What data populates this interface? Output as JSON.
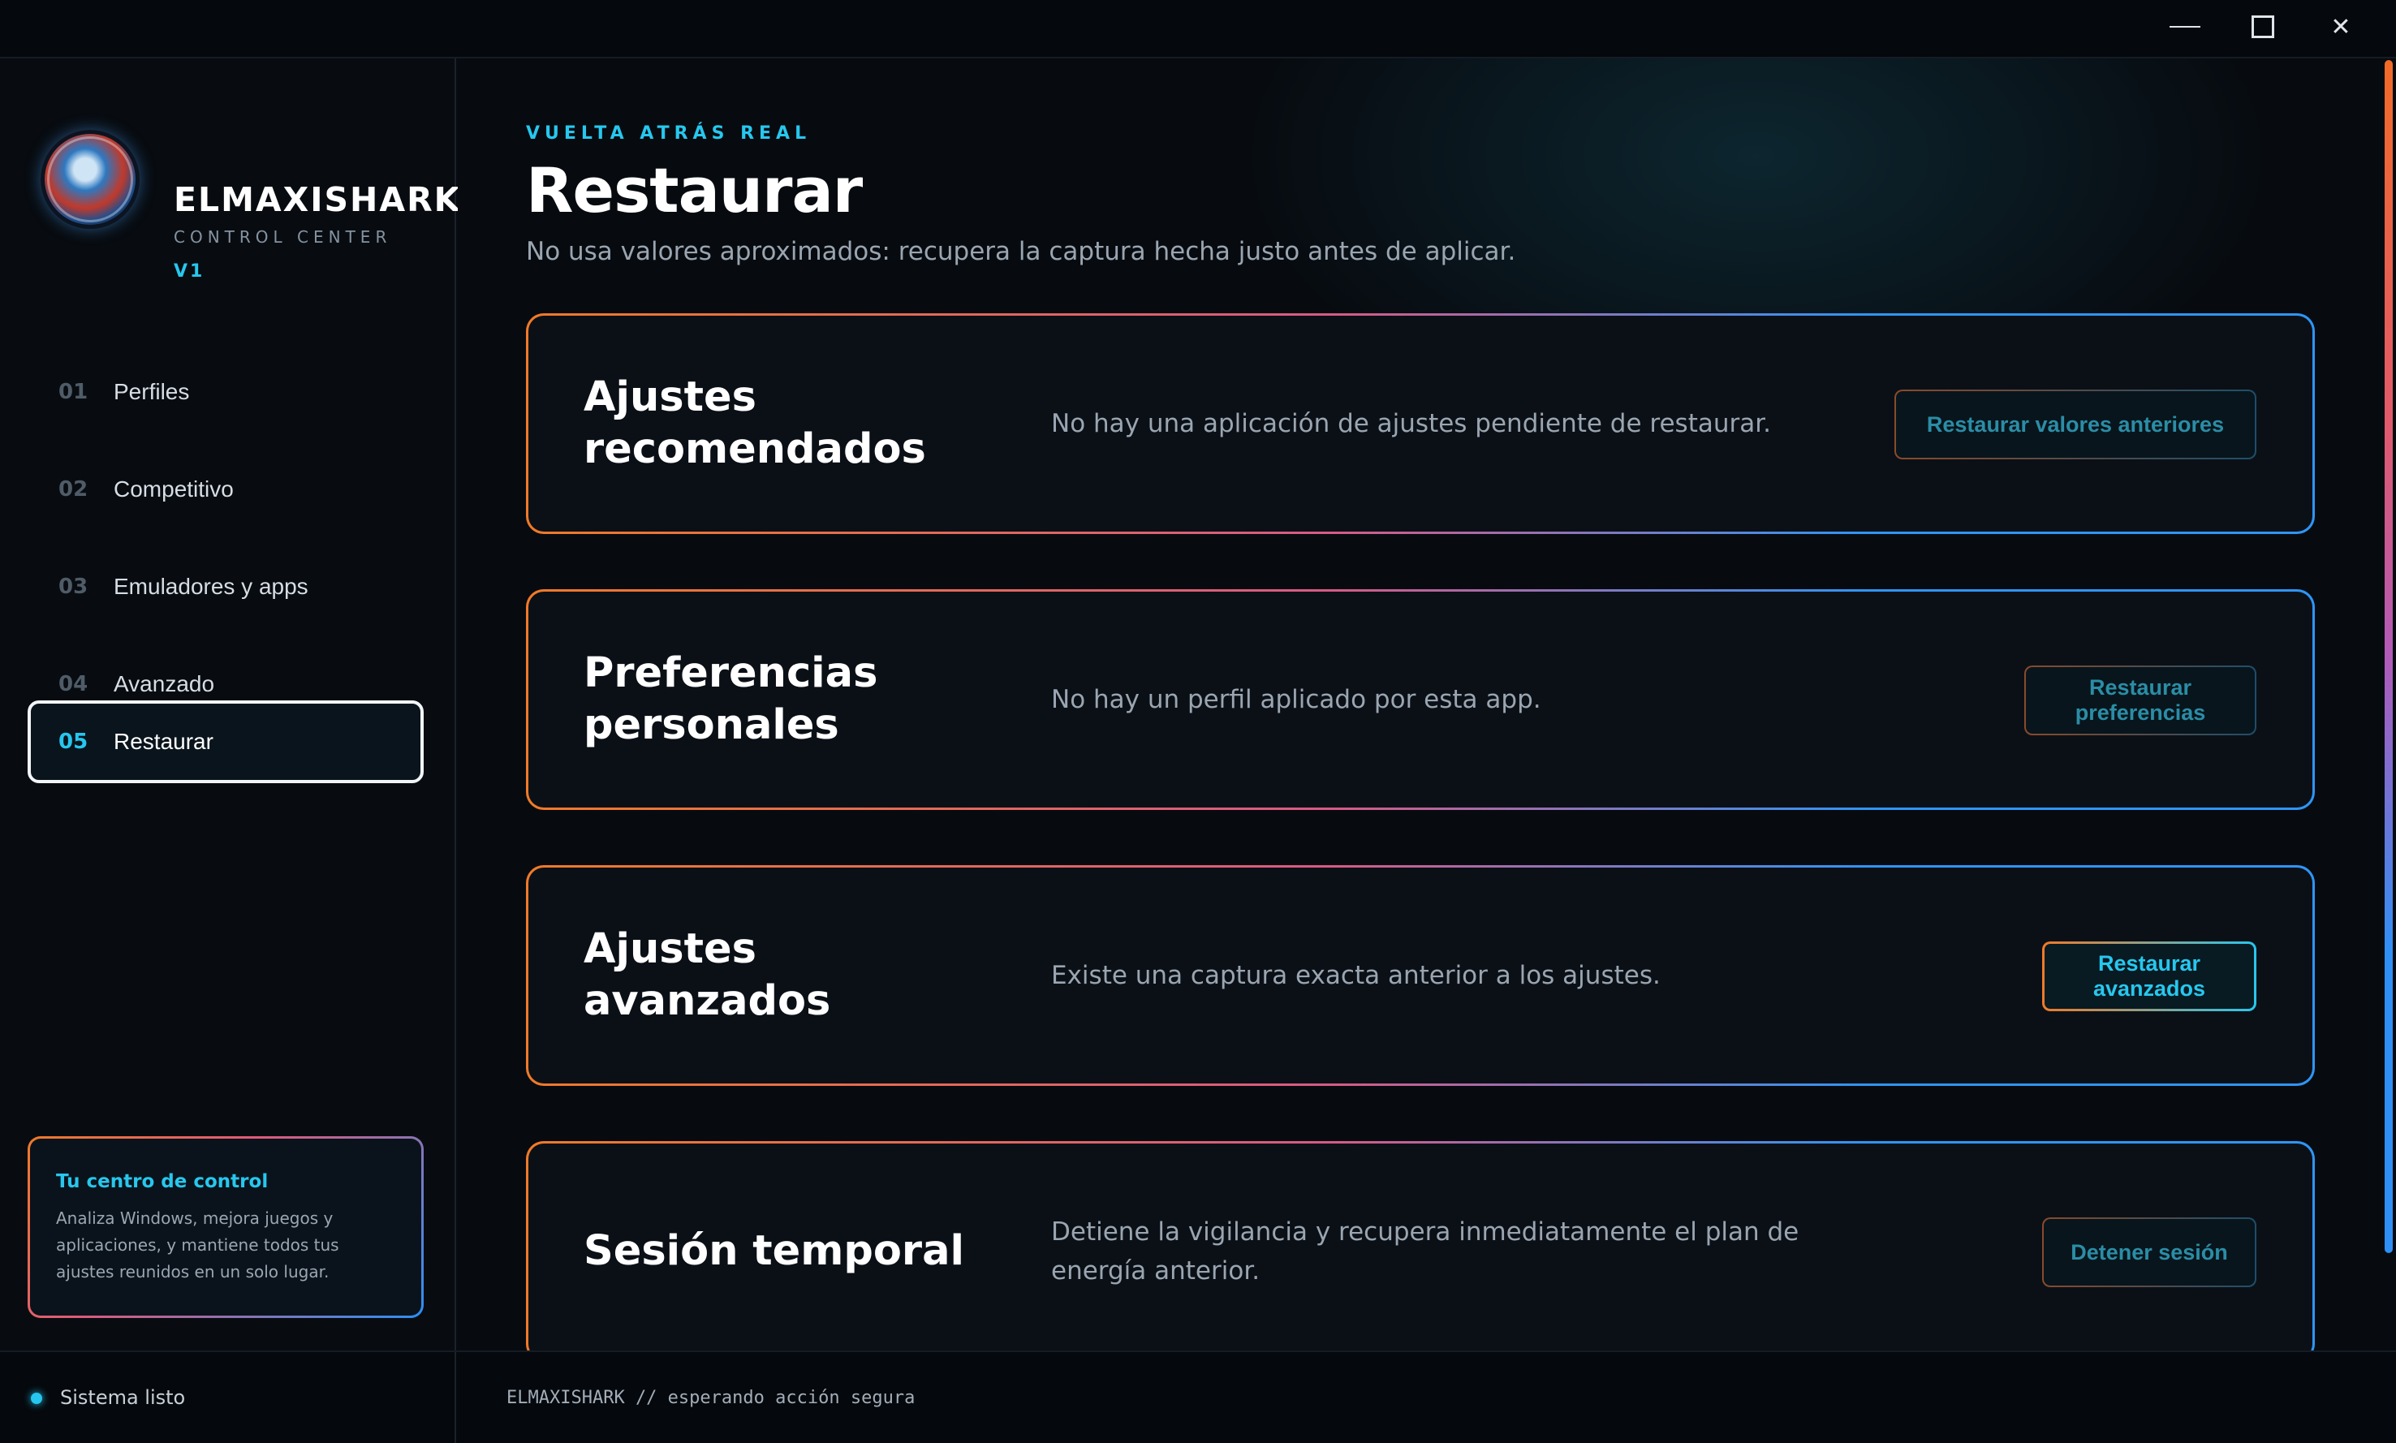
{
  "window": {
    "controls": {
      "minimize": "—",
      "maximize": "☐",
      "close": "✕"
    }
  },
  "brand": {
    "name": "ELMAXISHARK",
    "subtitle": "CONTROL CENTER",
    "version": "V1"
  },
  "nav": {
    "items": [
      {
        "num": "01",
        "label": "Perfiles",
        "active": false
      },
      {
        "num": "02",
        "label": "Competitivo",
        "active": false
      },
      {
        "num": "03",
        "label": "Emuladores y apps",
        "active": false
      },
      {
        "num": "04",
        "label": "Avanzado",
        "active": false
      },
      {
        "num": "05",
        "label": "Restaurar",
        "active": true
      }
    ]
  },
  "promo": {
    "title": "Tu centro de control",
    "text": "Analiza Windows, mejora juegos y aplicaciones, y mantiene todos tus ajustes reunidos en un solo lugar."
  },
  "page": {
    "eyebrow": "VUELTA ATRÁS REAL",
    "title": "Restaurar",
    "description": "No usa valores aproximados: recupera la captura hecha justo antes de aplicar."
  },
  "cards": [
    {
      "title": "Ajustes recomendados",
      "description": "No hay una aplicación de ajustes pendiente de restaurar.",
      "button": "Restaurar valores anteriores",
      "enabled": false
    },
    {
      "title": "Preferencias personales",
      "description": "No hay un perfil aplicado por esta app.",
      "button": "Restaurar preferencias",
      "enabled": false
    },
    {
      "title": "Ajustes avanzados",
      "description": "Existe una captura exacta anterior a los ajustes.",
      "button": "Restaurar avanzados",
      "enabled": true
    },
    {
      "title": "Sesión temporal",
      "description": "Detiene la vigilancia y recupera inmediatamente el plan de energía anterior.",
      "button": "Detener sesión",
      "enabled": false
    }
  ],
  "status": {
    "text": "Sistema listo",
    "console": "ELMAXISHARK // esperando acción segura"
  },
  "colors": {
    "accent": "#27c7ee",
    "orange": "#f07a28",
    "blue": "#2f95f6",
    "background": "#070b10"
  }
}
